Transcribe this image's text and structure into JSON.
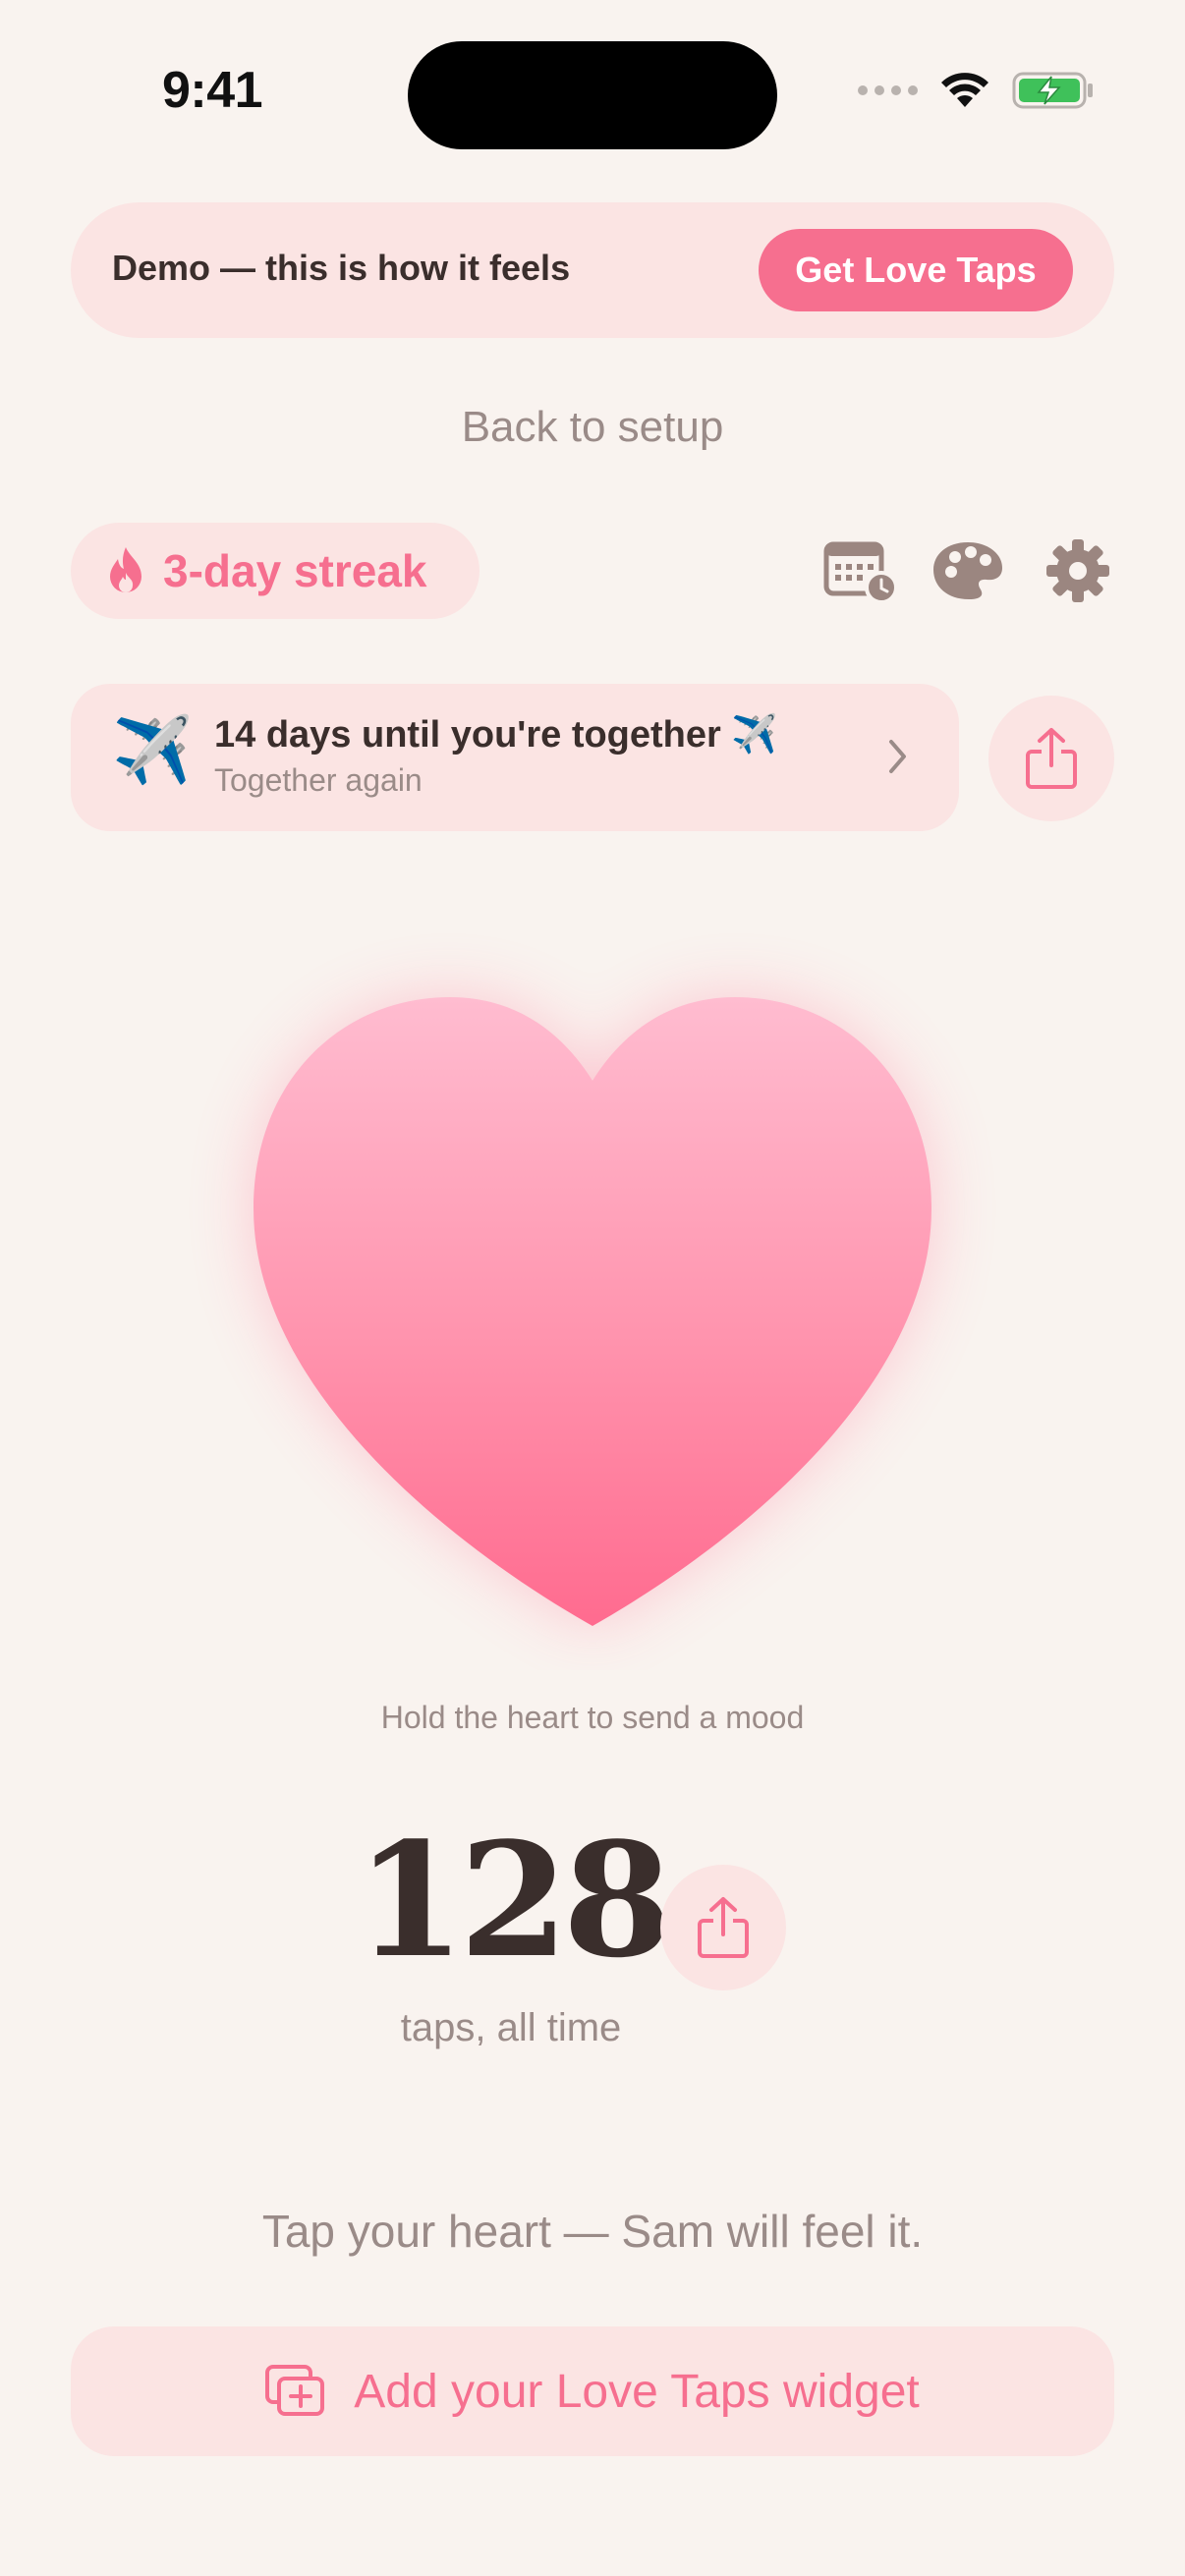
{
  "status_bar": {
    "time": "9:41"
  },
  "banner": {
    "text": "Demo — this is how it feels",
    "cta": "Get Love Taps"
  },
  "back_link": "Back to setup",
  "streak": {
    "label": "3-day streak"
  },
  "toolbar": {
    "icons": [
      "calendar-clock-icon",
      "palette-icon",
      "gear-icon"
    ]
  },
  "countdown": {
    "emoji": "✈️",
    "title": "14 days until you're together ✈️",
    "subtitle": "Together again"
  },
  "heart": {
    "hint": "Hold the heart to send a mood"
  },
  "taps": {
    "count": "128",
    "label": "taps, all time"
  },
  "tagline": "Tap your heart — Sam will feel it.",
  "widget_button": {
    "label": "Add your Love Taps widget"
  },
  "colors": {
    "accent": "#f66f8f",
    "background": "#f9f3ef",
    "pill": "#fbe4e3",
    "muted": "#9a8b88",
    "icon": "#9b8680"
  }
}
